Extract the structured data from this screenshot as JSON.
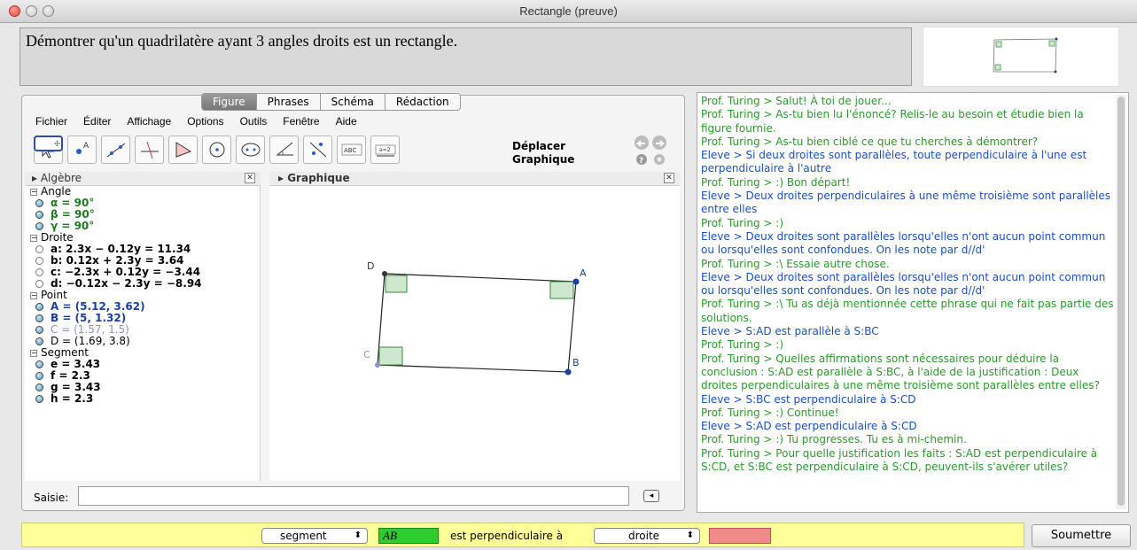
{
  "window": {
    "title": "Rectangle (preuve)"
  },
  "statement": "Démontrer qu'un quadrilatère ayant 3 angles droits est un rectangle.",
  "tabs": [
    "Figure",
    "Phrases",
    "Schéma",
    "Rédaction"
  ],
  "menu": [
    "Fichier",
    "Éditer",
    "Affichage",
    "Options",
    "Outils",
    "Fenêtre",
    "Aide"
  ],
  "tool_help": {
    "line1": "Déplacer",
    "line2": "Graphique"
  },
  "algebra": {
    "header": "Algèbre",
    "categories": {
      "angle": "Angle",
      "droite": "Droite",
      "point": "Point",
      "segment": "Segment"
    },
    "angles": [
      "α = 90°",
      "β = 90°",
      "γ = 90°"
    ],
    "lines": [
      "a: 2.3x − 0.12y = 11.34",
      "b: 0.12x + 2.3y = 3.64",
      "c: −2.3x + 0.12y = −3.44",
      "d: −0.12x − 2.3y = −8.94"
    ],
    "points": [
      "A = (5.12, 3.62)",
      "B = (5, 1.32)",
      "C = (1.57, 1.5)",
      "D = (1.69, 3.8)"
    ],
    "segments": [
      "e = 3.43",
      "f = 2.3",
      "g = 3.43",
      "h = 2.3"
    ]
  },
  "graphics": {
    "header": "Graphique",
    "labels": [
      "A",
      "B",
      "C",
      "D"
    ]
  },
  "input": {
    "label": "Saisie:"
  },
  "chat": [
    {
      "who": "prof",
      "text": "Prof. Turing >  Salut! À toi de jouer..."
    },
    {
      "who": "prof",
      "text": "Prof. Turing >  As-tu bien lu l'énoncé? Relis-le au besoin et étudie bien la figure fournie."
    },
    {
      "who": "prof",
      "text": "Prof. Turing >  As-tu bien ciblé ce que tu cherches à démontrer?"
    },
    {
      "who": "eleve",
      "text": "Eleve >  Si deux droites sont parallèles, toute perpendiculaire à l'une est perpendiculaire à l'autre"
    },
    {
      "who": "prof",
      "text": "Prof. Turing >  :) Bon départ!"
    },
    {
      "who": "eleve",
      "text": "Eleve >  Deux droites perpendiculaires à une même troisième sont parallèles entre elles"
    },
    {
      "who": "prof",
      "text": "Prof. Turing >  :)"
    },
    {
      "who": "eleve",
      "text": "Eleve >  Deux droites sont parallèles lorsqu'elles n'ont aucun point commun ou lorsqu'elles sont confondues. On les note par d//d'"
    },
    {
      "who": "prof",
      "text": "Prof. Turing >  :\\  Essaie autre chose."
    },
    {
      "who": "eleve",
      "text": "Eleve >  Deux droites sont parallèles lorsqu'elles n'ont aucun point commun ou lorsqu'elles sont confondues. On les note par d//d'"
    },
    {
      "who": "prof",
      "text": "Prof. Turing >  :\\  Tu as déjà mentionnée cette phrase qui ne fait pas partie des solutions."
    },
    {
      "who": "eleve",
      "text": "Eleve >  S:AD est parallèle à S:BC"
    },
    {
      "who": "prof",
      "text": "Prof. Turing >  :)"
    },
    {
      "who": "prof",
      "text": "Prof. Turing >  Quelles affirmations sont nécessaires pour déduire la conclusion : S:AD est parallèle à S:BC, à l'aide de la justification : Deux droites perpendiculaires à une même troisième sont parallèles entre elles?"
    },
    {
      "who": "eleve",
      "text": "Eleve >  S:BC est perpendiculaire à S:CD"
    },
    {
      "who": "prof",
      "text": "Prof. Turing >  :) Continue!"
    },
    {
      "who": "eleve",
      "text": "Eleve >  S:AD est perpendiculaire à S:CD"
    },
    {
      "who": "prof",
      "text": "Prof. Turing >  :) Tu progresses. Tu es à mi-chemin."
    },
    {
      "who": "prof",
      "text": "Prof. Turing >  Pour quelle justification les faits : S:AD est perpendiculaire à S:CD, et S:BC est perpendiculaire à S:CD, peuvent-ils s'avérer utiles?"
    }
  ],
  "bottom": {
    "select1": "segment",
    "green_value": "AB",
    "middle_text": "est perpendiculaire à",
    "select2": "droite",
    "submit": "Soumettre"
  }
}
